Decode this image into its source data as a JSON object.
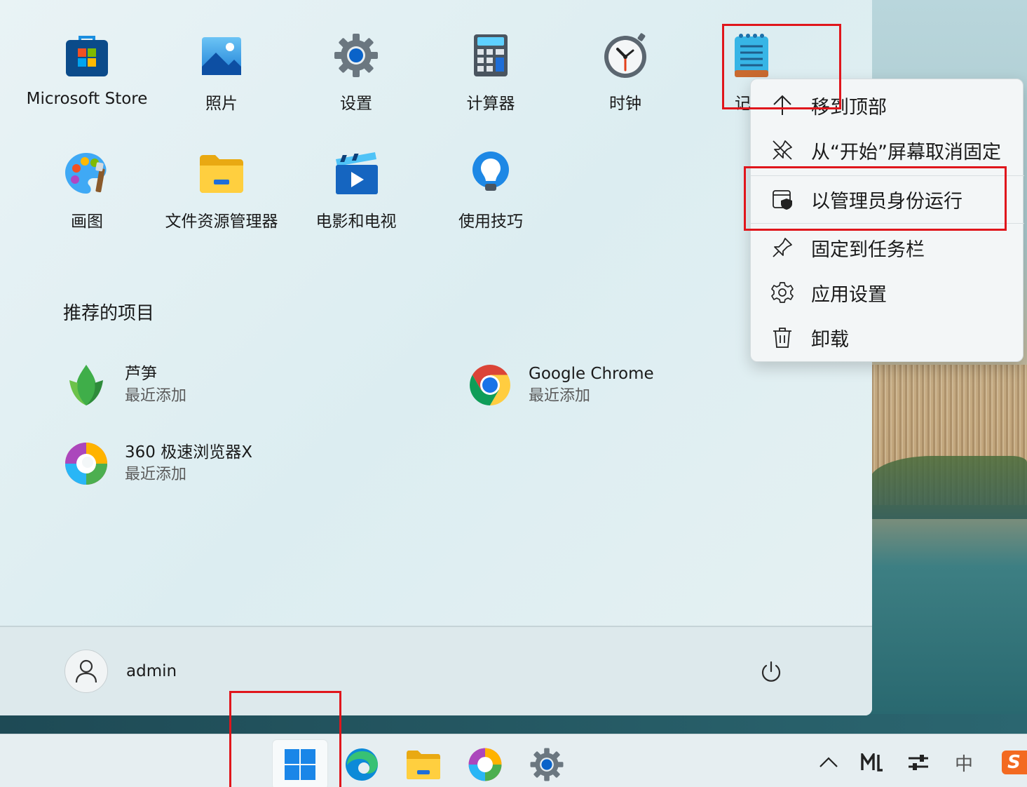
{
  "pinned_apps": [
    {
      "label": "Microsoft Store",
      "icon": "microsoft-store-icon"
    },
    {
      "label": "照片",
      "icon": "photos-icon"
    },
    {
      "label": "设置",
      "icon": "settings-gear-icon"
    },
    {
      "label": "计算器",
      "icon": "calculator-icon"
    },
    {
      "label": "时钟",
      "icon": "clock-icon"
    },
    {
      "label": "记",
      "icon": "notepad-icon"
    },
    {
      "label": "画图",
      "icon": "paint-icon"
    },
    {
      "label": "文件资源管理器",
      "icon": "file-explorer-icon"
    },
    {
      "label": "电影和电视",
      "icon": "movies-tv-icon"
    },
    {
      "label": "使用技巧",
      "icon": "tips-icon"
    }
  ],
  "recommended": {
    "title": "推荐的项目",
    "items": [
      {
        "name": "芦笋",
        "sub": "最近添加",
        "icon": "asparagus-icon"
      },
      {
        "name": "Google Chrome",
        "sub": "最近添加",
        "icon": "chrome-icon"
      },
      {
        "name": "360 极速浏览器X",
        "sub": "最近添加",
        "icon": "360-browser-icon"
      }
    ]
  },
  "user": {
    "name": "admin"
  },
  "context_menu": {
    "items": [
      {
        "label": "移到顶部",
        "icon": "arrow-up-icon"
      },
      {
        "label": "从“开始”屏幕取消固定",
        "icon": "unpin-icon"
      },
      {
        "label": "以管理员身份运行",
        "icon": "run-as-admin-icon"
      },
      {
        "label": "固定到任务栏",
        "icon": "pin-icon"
      },
      {
        "label": "应用设置",
        "icon": "gear-icon"
      },
      {
        "label": "卸载",
        "icon": "trash-icon"
      }
    ]
  },
  "taskbar": {
    "items": [
      "start-icon",
      "edge-icon",
      "file-explorer-icon",
      "360-browser-icon",
      "settings-gear-icon"
    ],
    "tray": {
      "chevron": "chevron-up-icon",
      "ime_label": "中",
      "ime_brand": "S"
    }
  },
  "colors": {
    "highlight": "#e0161c",
    "accent": "#0067c0"
  }
}
